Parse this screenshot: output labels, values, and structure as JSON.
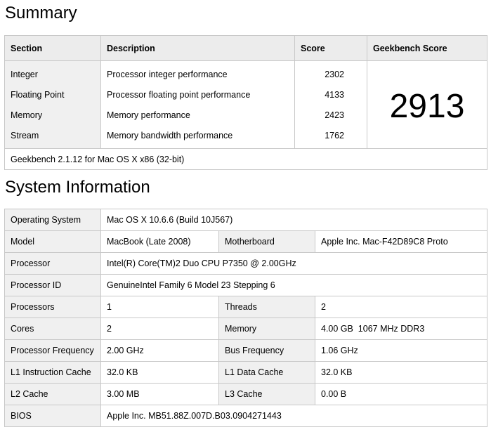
{
  "summary": {
    "heading": "Summary",
    "columns": {
      "section": "Section",
      "description": "Description",
      "score": "Score",
      "geekbench": "Geekbench Score"
    },
    "rows": [
      {
        "section": "Integer",
        "description": "Processor integer performance",
        "score": "2302"
      },
      {
        "section": "Floating Point",
        "description": "Processor floating point performance",
        "score": "4133"
      },
      {
        "section": "Memory",
        "description": "Memory performance",
        "score": "2423"
      },
      {
        "section": "Stream",
        "description": "Memory bandwidth performance",
        "score": "1762"
      }
    ],
    "geekbench_score": "2913",
    "footer": "Geekbench 2.1.12 for Mac OS X x86 (32-bit)"
  },
  "system": {
    "heading": "System Information",
    "os_label": "Operating System",
    "os_value": "Mac OS X 10.6.6 (Build 10J567)",
    "model_label": "Model",
    "model_value": "MacBook (Late 2008)",
    "motherboard_label": "Motherboard",
    "motherboard_value": "Apple Inc. Mac-F42D89C8 Proto",
    "processor_label": "Processor",
    "processor_value": "Intel(R) Core(TM)2 Duo CPU P7350 @ 2.00GHz",
    "processor_id_label": "Processor ID",
    "processor_id_value": "GenuineIntel Family 6 Model 23 Stepping 6",
    "processors_label": "Processors",
    "processors_value": "1",
    "threads_label": "Threads",
    "threads_value": "2",
    "cores_label": "Cores",
    "cores_value": "2",
    "memory_label": "Memory",
    "memory_value": "4.00 GB  1067 MHz DDR3",
    "proc_freq_label": "Processor Frequency",
    "proc_freq_value": "2.00 GHz",
    "bus_freq_label": "Bus Frequency",
    "bus_freq_value": "1.06 GHz",
    "l1i_label": "L1 Instruction Cache",
    "l1i_value": "32.0 KB",
    "l1d_label": "L1 Data Cache",
    "l1d_value": "32.0 KB",
    "l2_label": "L2 Cache",
    "l2_value": "3.00 MB",
    "l3_label": "L3 Cache",
    "l3_value": "0.00 B",
    "bios_label": "BIOS",
    "bios_value": "Apple Inc. MB51.88Z.007D.B03.0904271443"
  }
}
